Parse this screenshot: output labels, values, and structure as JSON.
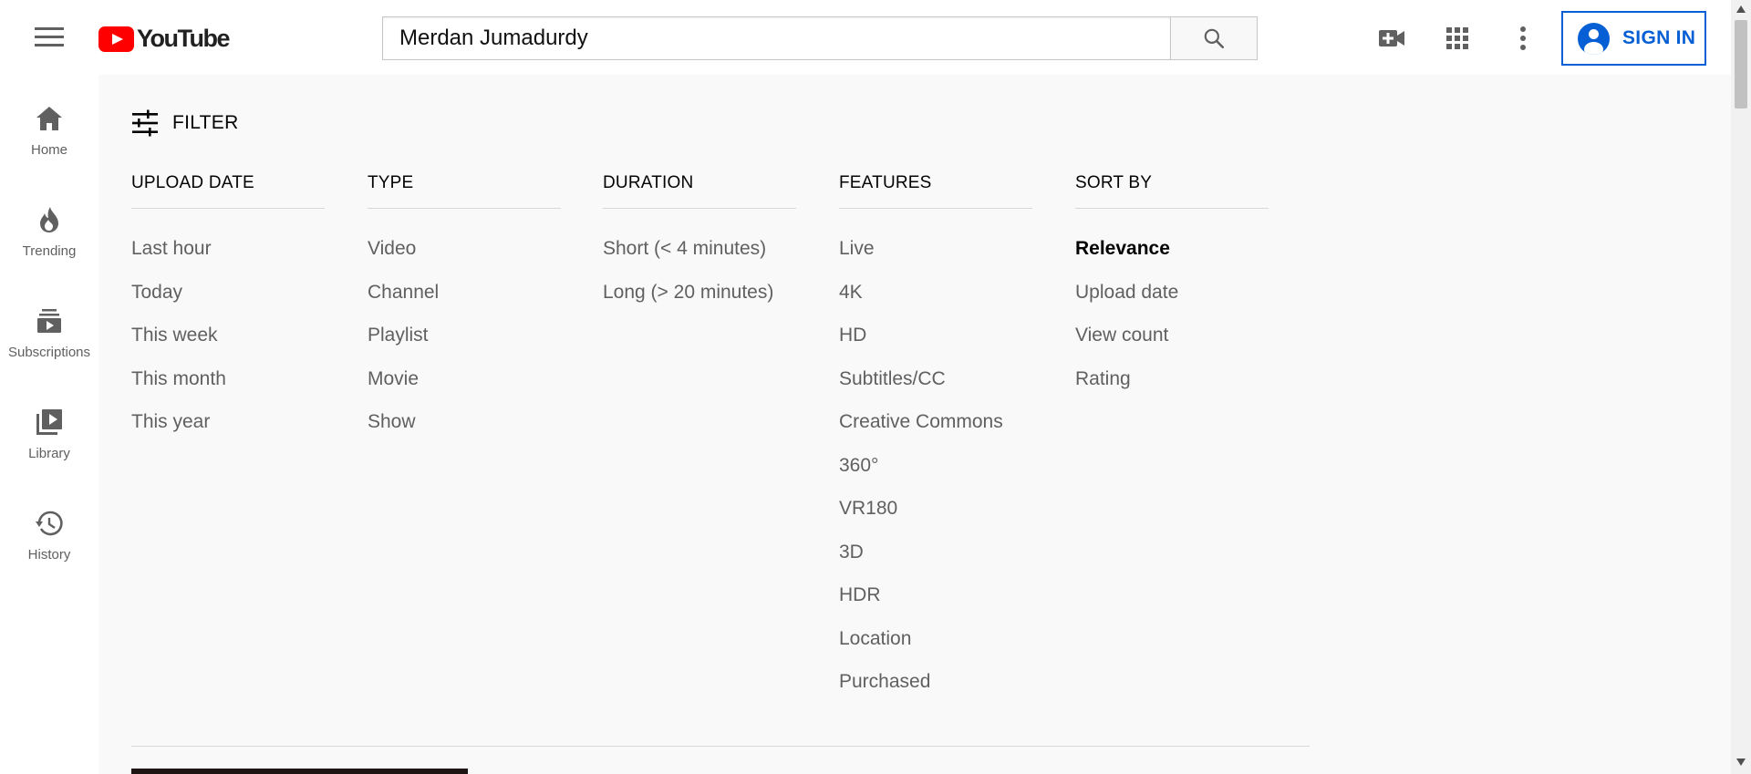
{
  "header": {
    "logo_text": "YouTube",
    "search": {
      "value": "Merdan Jumadurdy",
      "placeholder": "Search"
    },
    "signin_label": "SIGN IN",
    "icons": [
      "menu-icon",
      "search-icon",
      "video-create-icon",
      "apps-grid-icon",
      "more-vert-icon",
      "account-icon"
    ],
    "colors": {
      "brand_red": "#ff0000",
      "link_blue": "#065fd4"
    }
  },
  "sidebar": {
    "items": [
      {
        "label": "Home",
        "icon": "home-icon"
      },
      {
        "label": "Trending",
        "icon": "trending-icon"
      },
      {
        "label": "Subscriptions",
        "icon": "subscriptions-icon"
      },
      {
        "label": "Library",
        "icon": "library-icon"
      },
      {
        "label": "History",
        "icon": "history-icon"
      }
    ]
  },
  "filter": {
    "toggle_label": "FILTER",
    "groups": [
      {
        "title": "UPLOAD DATE",
        "options": [
          "Last hour",
          "Today",
          "This week",
          "This month",
          "This year"
        ]
      },
      {
        "title": "TYPE",
        "options": [
          "Video",
          "Channel",
          "Playlist",
          "Movie",
          "Show"
        ]
      },
      {
        "title": "DURATION",
        "options": [
          "Short (< 4 minutes)",
          "Long (> 20 minutes)"
        ]
      },
      {
        "title": "FEATURES",
        "options": [
          "Live",
          "4K",
          "HD",
          "Subtitles/CC",
          "Creative Commons",
          "360°",
          "VR180",
          "3D",
          "HDR",
          "Location",
          "Purchased"
        ]
      },
      {
        "title": "SORT BY",
        "options": [
          "Relevance",
          "Upload date",
          "View count",
          "Rating"
        ],
        "selected": "Relevance"
      }
    ]
  }
}
